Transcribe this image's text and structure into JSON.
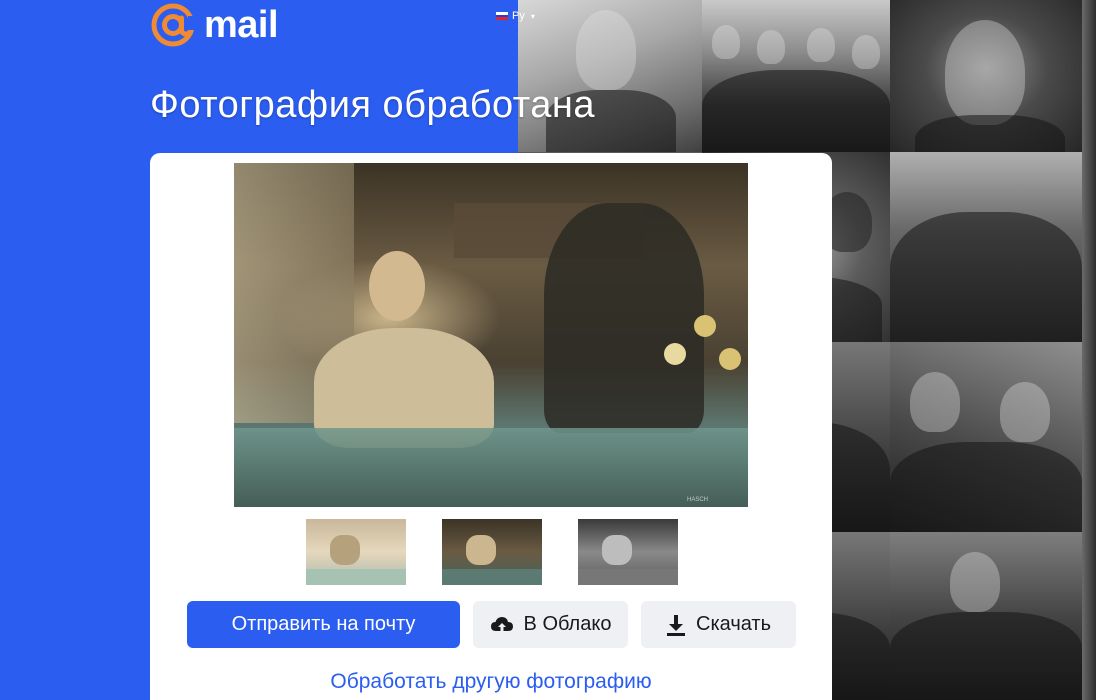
{
  "header": {
    "logo_text": "mail",
    "language": "Ру"
  },
  "page": {
    "title": "Фотография обработана"
  },
  "photo": {
    "watermark": "HASCH"
  },
  "thumbnails": [
    {
      "label": "variant-light"
    },
    {
      "label": "variant-color"
    },
    {
      "label": "variant-bw"
    }
  ],
  "actions": {
    "send_email": "Отправить на почту",
    "to_cloud": "В Облако",
    "download": "Скачать"
  },
  "links": {
    "process_another": "Обработать другую фотографию"
  },
  "colors": {
    "brand_blue": "#2a5df0",
    "logo_orange": "#f08a33",
    "secondary_button": "#eef0f4"
  },
  "icons": {
    "logo": "at-sign-icon",
    "cloud": "cloud-upload-icon",
    "download": "download-icon",
    "flag": "russia-flag-icon",
    "caret": "chevron-down-icon"
  }
}
